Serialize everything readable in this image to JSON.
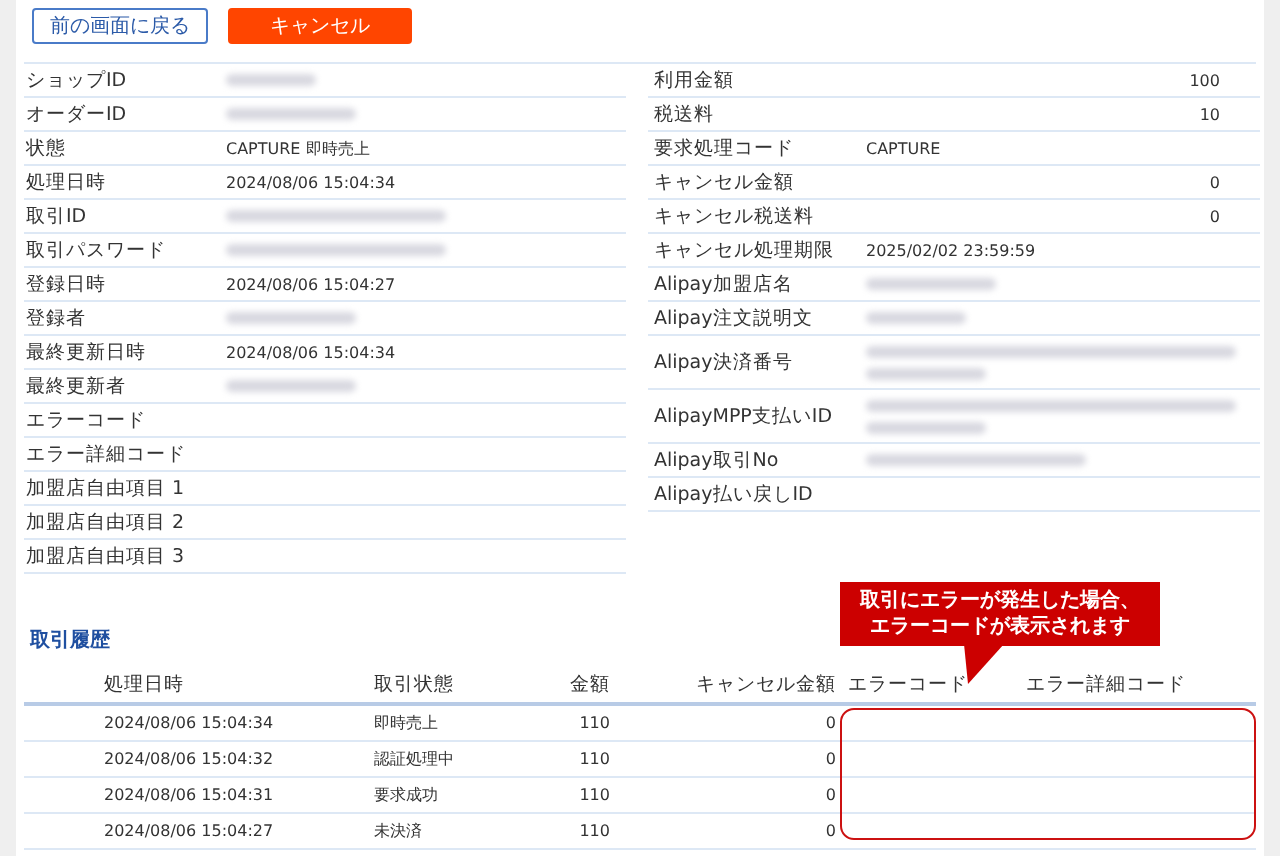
{
  "buttons": [
    {
      "label": "前の画面に戻る",
      "kind": "outline"
    },
    {
      "label": "キャンセル",
      "kind": "danger"
    }
  ],
  "details_left": [
    {
      "label": "ショップID",
      "blurred": true
    },
    {
      "label": "オーダーID",
      "blurred": true
    },
    {
      "label": "状態",
      "value": "CAPTURE 即時売上"
    },
    {
      "label": "処理日時",
      "value": "2024/08/06 15:04:34"
    },
    {
      "label": "取引ID",
      "blurred": true
    },
    {
      "label": "取引パスワード",
      "blurred": true
    },
    {
      "label": "登録日時",
      "value": "2024/08/06 15:04:27"
    },
    {
      "label": "登録者",
      "blurred": true
    },
    {
      "label": "最終更新日時",
      "value": "2024/08/06 15:04:34"
    },
    {
      "label": "最終更新者",
      "blurred": true
    },
    {
      "label": "エラーコード"
    },
    {
      "label": "エラー詳細コード"
    },
    {
      "label": "加盟店自由項目 1"
    },
    {
      "label": "加盟店自由項目 2"
    },
    {
      "label": "加盟店自由項目 3"
    }
  ],
  "details_right": [
    {
      "label": "利用金額",
      "amount": "100"
    },
    {
      "label": "税送料",
      "amount": "10"
    },
    {
      "label": "要求処理コード",
      "value": "CAPTURE"
    },
    {
      "label": "キャンセル金額",
      "amount": "0"
    },
    {
      "label": "キャンセル税送料",
      "amount": "0"
    },
    {
      "label": "キャンセル処理期限",
      "value": "2025/02/02 23:59:59"
    },
    {
      "label": "Alipay加盟店名",
      "blurred": true
    },
    {
      "label": "Alipay注文説明文",
      "blurred": true
    },
    {
      "label": "Alipay決済番号",
      "blurred": true,
      "wrapped": true
    },
    {
      "label": "AlipayMPP支払いID",
      "blurred": true,
      "wrapped": true
    },
    {
      "label": "Alipay取引No",
      "blurred": true
    },
    {
      "label": "Alipay払い戻しID"
    }
  ],
  "history": {
    "title": "取引履歴",
    "columns": [
      "処理日時",
      "取引状態",
      "金額",
      "キャンセル金額",
      "エラーコード",
      "エラー詳細コード"
    ],
    "rows": [
      {
        "date": "2024/08/06 15:04:34",
        "status": "即時売上",
        "amount": "110",
        "cancel_amount": "0"
      },
      {
        "date": "2024/08/06 15:04:32",
        "status": "認証処理中",
        "amount": "110",
        "cancel_amount": "0"
      },
      {
        "date": "2024/08/06 15:04:31",
        "status": "要求成功",
        "amount": "110",
        "cancel_amount": "0"
      },
      {
        "date": "2024/08/06 15:04:27",
        "status": "未決済",
        "amount": "110",
        "cancel_amount": "0"
      }
    ]
  },
  "callout": {
    "lines": [
      "取引にエラーが発生した場合、",
      "エラーコードが表示されます"
    ]
  }
}
